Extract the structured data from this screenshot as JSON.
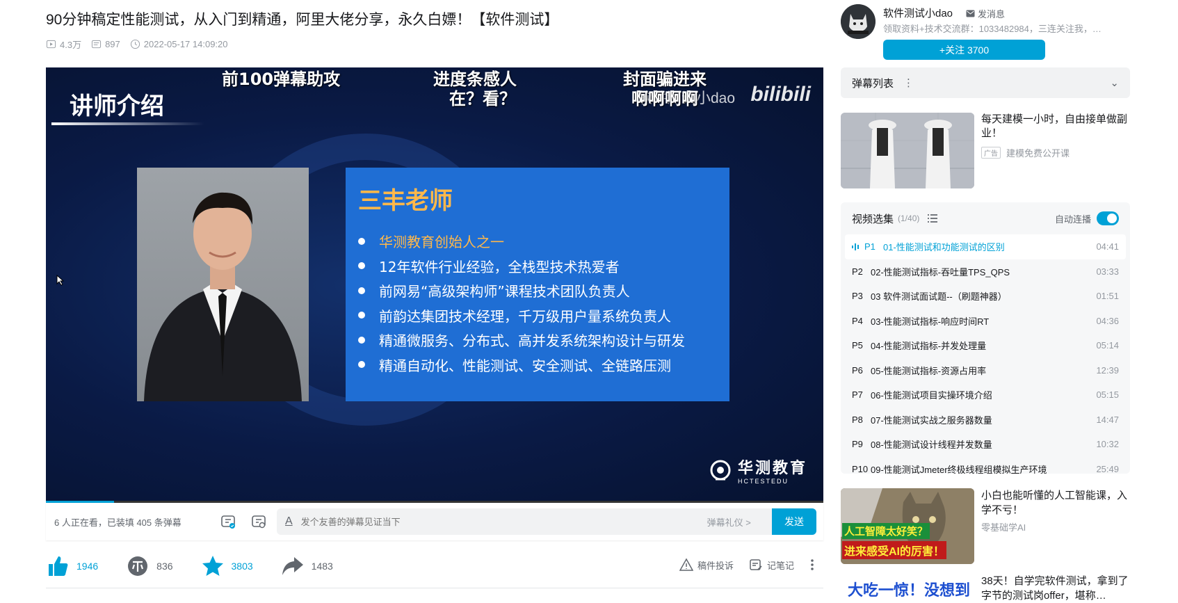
{
  "video": {
    "title": "90分钟稿定性能测试，从入门到精通，阿里大佬分享，永久白嫖！【软件测试】",
    "views": "4.3万",
    "danmaku_count": "897",
    "published": "2022-05-17 14:09:20"
  },
  "frame": {
    "danmaku": [
      "前100弹幕助攻",
      "进度条感人",
      "在？看？",
      "封面骗进来",
      "啊啊啊啊"
    ],
    "watermark": "软件测试小dao",
    "site_logo": "bilibili",
    "heading": "讲师介绍",
    "teacher_name": "三丰老师",
    "bullets": [
      "华测教育创始人之一",
      "12年软件行业经验，全栈型技术热爱者",
      "前网易“高级架构师”课程技术团队负责人",
      "前韵达集团技术经理，千万级用户量系统负责人",
      "精通微服务、分布式、高并发系统架构设计与研发",
      "精通自动化、性能测试、安全测试、全链路压测"
    ],
    "brand_cn": "华测教育",
    "brand_en": "HCTESTEDU",
    "progress": 0.088
  },
  "danmaku_bar": {
    "viewers": "6 人正在看，已装填 405 条弹幕",
    "placeholder": "发个友善的弹幕见证当下",
    "etiquette": "弹幕礼仪 >",
    "send": "发送"
  },
  "toolbar": {
    "like": "1946",
    "coin": "836",
    "favorite": "3803",
    "share": "1483",
    "report": "稿件投诉",
    "note": "记笔记"
  },
  "uploader": {
    "name": "软件测试小dao",
    "message": "发消息",
    "desc": "领取资料+技术交流群：1033482984，三连关注我，…",
    "follow": "+关注 3700"
  },
  "danmaku_list": {
    "label": "弹幕列表"
  },
  "ad": {
    "title": "每天建模一小时，自由接单做副业！",
    "tag": "广告",
    "source": "建模免费公开课"
  },
  "playlist": {
    "label": "视频选集",
    "count": "(1/40)",
    "autoplay": "自动连播",
    "episodes": [
      {
        "p": "P1",
        "name": "01-性能测试和功能测试的区别",
        "dur": "04:41"
      },
      {
        "p": "P2",
        "name": "02-性能测试指标-吞吐量TPS_QPS",
        "dur": "03:33"
      },
      {
        "p": "P3",
        "name": "03 软件测试面试题--（刷题神器）",
        "dur": "01:51"
      },
      {
        "p": "P4",
        "name": "03-性能测试指标-响应时间RT",
        "dur": "04:36"
      },
      {
        "p": "P5",
        "name": "04-性能测试指标-并发处理量",
        "dur": "05:14"
      },
      {
        "p": "P6",
        "name": "05-性能测试指标-资源占用率",
        "dur": "12:39"
      },
      {
        "p": "P7",
        "name": "06-性能测试项目实操环境介绍",
        "dur": "05:15"
      },
      {
        "p": "P8",
        "name": "07-性能测试实战之服务器数量",
        "dur": "14:47"
      },
      {
        "p": "P9",
        "name": "08-性能测试设计线程并发数量",
        "dur": "10:32"
      },
      {
        "p": "P10",
        "name": "09-性能测试Jmeter终极线程组模拟生产环境",
        "dur": "25:49"
      }
    ]
  },
  "recommend": [
    {
      "title": "小白也能听懂的人工智能课，入学不亏！",
      "up": "零基础学AI",
      "thumb_text1": "人工智障太好笑？",
      "thumb_text2": "进来感受AI的厉害！"
    },
    {
      "title": "38天！自学完软件测试，拿到了字节的测试岗offer，堪称…",
      "thumb_text": "大吃一惊！没想到"
    }
  ]
}
